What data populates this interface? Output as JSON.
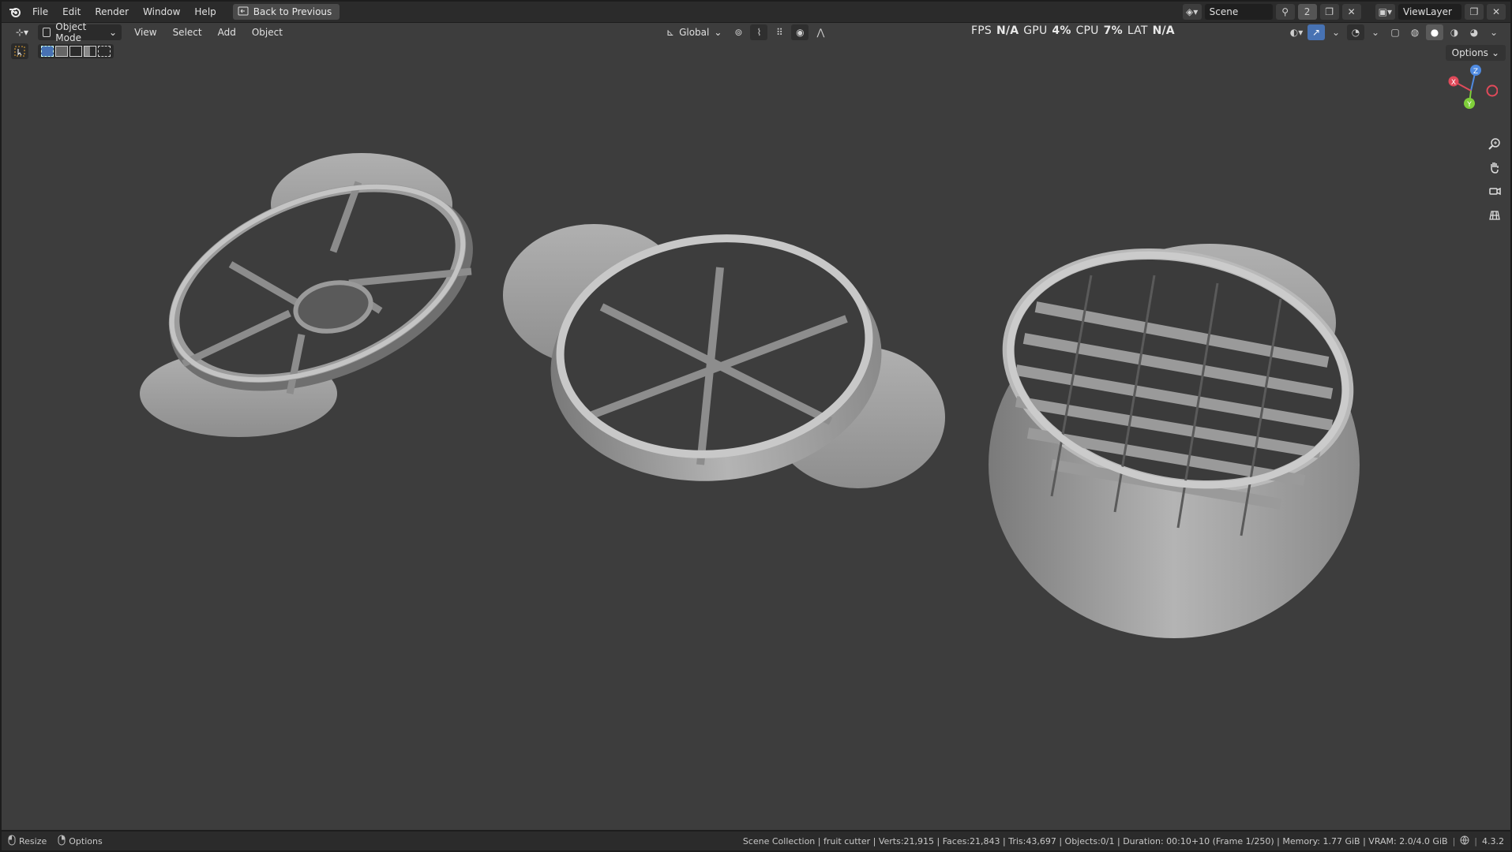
{
  "menubar": {
    "items": [
      "File",
      "Edit",
      "Render",
      "Window",
      "Help"
    ],
    "back_label": "Back to Previous",
    "scene_name": "Scene",
    "scene_users": "2",
    "view_layer": "ViewLayer"
  },
  "viewport_header": {
    "mode": "Object Mode",
    "menus": [
      "View",
      "Select",
      "Add",
      "Object"
    ],
    "orientation": "Global",
    "options_label": "Options"
  },
  "perf": {
    "fps_label": "FPS",
    "fps": "N/A",
    "gpu_label": "GPU",
    "gpu": "4%",
    "cpu_label": "CPU",
    "cpu": "7%",
    "lat_label": "LAT",
    "lat": "N/A"
  },
  "gizmo": {
    "x": "X",
    "y": "Y",
    "z": "Z"
  },
  "status": {
    "resize_label": "Resize",
    "options_label": "Options",
    "info": "Scene Collection | fruit cutter | Verts:21,915 | Faces:21,843 | Tris:43,697 | Objects:0/1 | Duration: 00:10+10 (Frame 1/250) | Memory: 1.77 GiB | VRAM: 2.0/4.0 GiB",
    "version": "4.3.2"
  },
  "colors": {
    "viewport_bg": "#3d3d3d",
    "header_bg": "#2b2b2b",
    "accent": "#4772b3",
    "mesh": "#a9a9a9"
  },
  "icons": [
    "blender-logo-icon",
    "editor-type-icon",
    "object-mode-icon",
    "orientation-icon",
    "snap-icon",
    "proportional-icon",
    "visibility-icon",
    "gizmo-icon",
    "overlay-icon",
    "xray-icon",
    "wireframe-shading-icon",
    "solid-shading-icon",
    "material-shading-icon",
    "rendered-shading-icon",
    "zoom-icon",
    "pan-icon",
    "camera-icon",
    "grid-icon"
  ]
}
